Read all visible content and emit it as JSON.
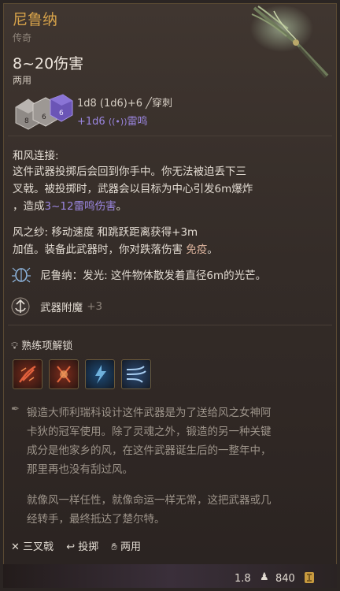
{
  "item": {
    "name": "尼鲁纳",
    "rarity": "传奇",
    "damage": "8~20伤害",
    "handedness": "两用",
    "damage_roll": "1d8 (1d6)+6",
    "damage_type": "穿刺",
    "bonus_roll": "+1d6",
    "bonus_type": "雷鸣",
    "dice_labels": [
      "8",
      "6",
      "6"
    ]
  },
  "ability": {
    "title": "和风连接:",
    "line1": "这件武器投掷后会回到你手中。你无法被迫丢下三",
    "line2": "叉戟。被投掷时，武器会以目标为中心引发6m爆炸",
    "line3_prefix": "，造成",
    "line3_highlight": "3~12雷鸣伤害",
    "line3_suffix": "。"
  },
  "wind_feet": {
    "line1": "风之纱: 移动速度 和跳跃距离获得+3m",
    "line2_prefix": "加值。装备此武器时，你对跌落伤害 ",
    "line2_highlight": "免疫",
    "line2_suffix": "。"
  },
  "glow": {
    "text": "尼鲁纳：发光: 这件物体散发着直径6m的光芒。"
  },
  "enchant": {
    "label": "武器附魔",
    "value": "+3"
  },
  "mastery": {
    "title": "熟练项解锁",
    "slots": [
      {
        "icon": "flame-slash-icon",
        "color": "#c0492b"
      },
      {
        "icon": "flame-strike-icon",
        "color": "#c44a2e"
      },
      {
        "icon": "lightning-strike-icon",
        "color": "#3f86c6"
      },
      {
        "icon": "wind-gust-icon",
        "color": "#5a86b8"
      }
    ]
  },
  "lore": {
    "p1_l1": "锻造大师利瑞科设计这件武器是为了送给风之女神阿",
    "p1_l2": "卡狄的冠军使用。除了灵魂之外，锻造的另一种关键",
    "p1_l3": "成分是他家乡的风，在这件武器诞生后的一整年中，",
    "p1_l4": "那里再也没有刮过风。",
    "p2_l1": "就像风一样任性，就像命运一样无常，这把武器或几",
    "p2_l2": "经转手，最终抵达了楚尔特。"
  },
  "tags": {
    "t1": "三叉戟",
    "t2": "投掷",
    "t3": "两用"
  },
  "footer": {
    "weight": "1.8",
    "price": "840"
  }
}
